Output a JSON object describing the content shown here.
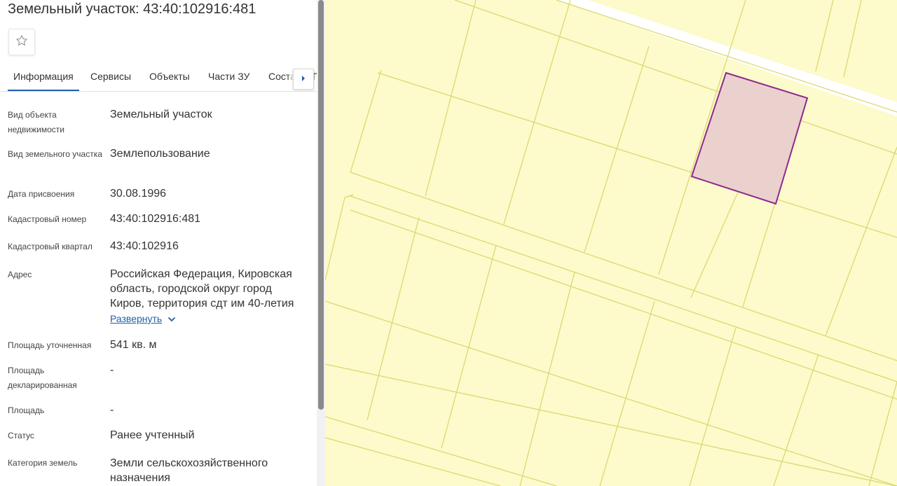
{
  "title": "Земельный участок: 43:40:102916:481",
  "tabs": [
    {
      "label": "Информация"
    },
    {
      "label": "Сервисы"
    },
    {
      "label": "Объекты"
    },
    {
      "label": "Части ЗУ"
    },
    {
      "label": "Соста"
    }
  ],
  "tab_partial": "П",
  "icons": {
    "favorite": "star-outline-icon",
    "tabs_next": "chevron-right-icon",
    "expand": "chevron-down-icon"
  },
  "properties": [
    {
      "label": "Вид объекта недвижимости",
      "value": "Земельный участок"
    },
    {
      "label": "Вид земельного участка",
      "value": "Землепользование"
    },
    {
      "label": "Дата присвоения",
      "value": "30.08.1996"
    },
    {
      "label": "Кадастровый номер",
      "value": "43:40:102916:481"
    },
    {
      "label": "Кадастровый квартал",
      "value": "43:40:102916"
    },
    {
      "label": "Адрес",
      "value": "Российская Федерация, Кировская область, городской округ город Киров, территория сдт им 40-летия"
    },
    {
      "label": "Площадь уточненная",
      "value": "541 кв. м"
    },
    {
      "label": "Площадь декларированная",
      "value": "-"
    },
    {
      "label": "Площадь",
      "value": "-"
    },
    {
      "label": "Статус",
      "value": "Ранее учтенный"
    },
    {
      "label": "Категория земель",
      "value": "Земли сельскохозяйственного назначения"
    }
  ],
  "expand_label": "Развернуть",
  "colors": {
    "accent": "#1f5fae",
    "map_background": "#fdfacb",
    "parcel_lines": "#d9d76a",
    "selected_fill": "#ead1cd",
    "selected_stroke": "#8e2a8e",
    "road": "#ffffff"
  }
}
